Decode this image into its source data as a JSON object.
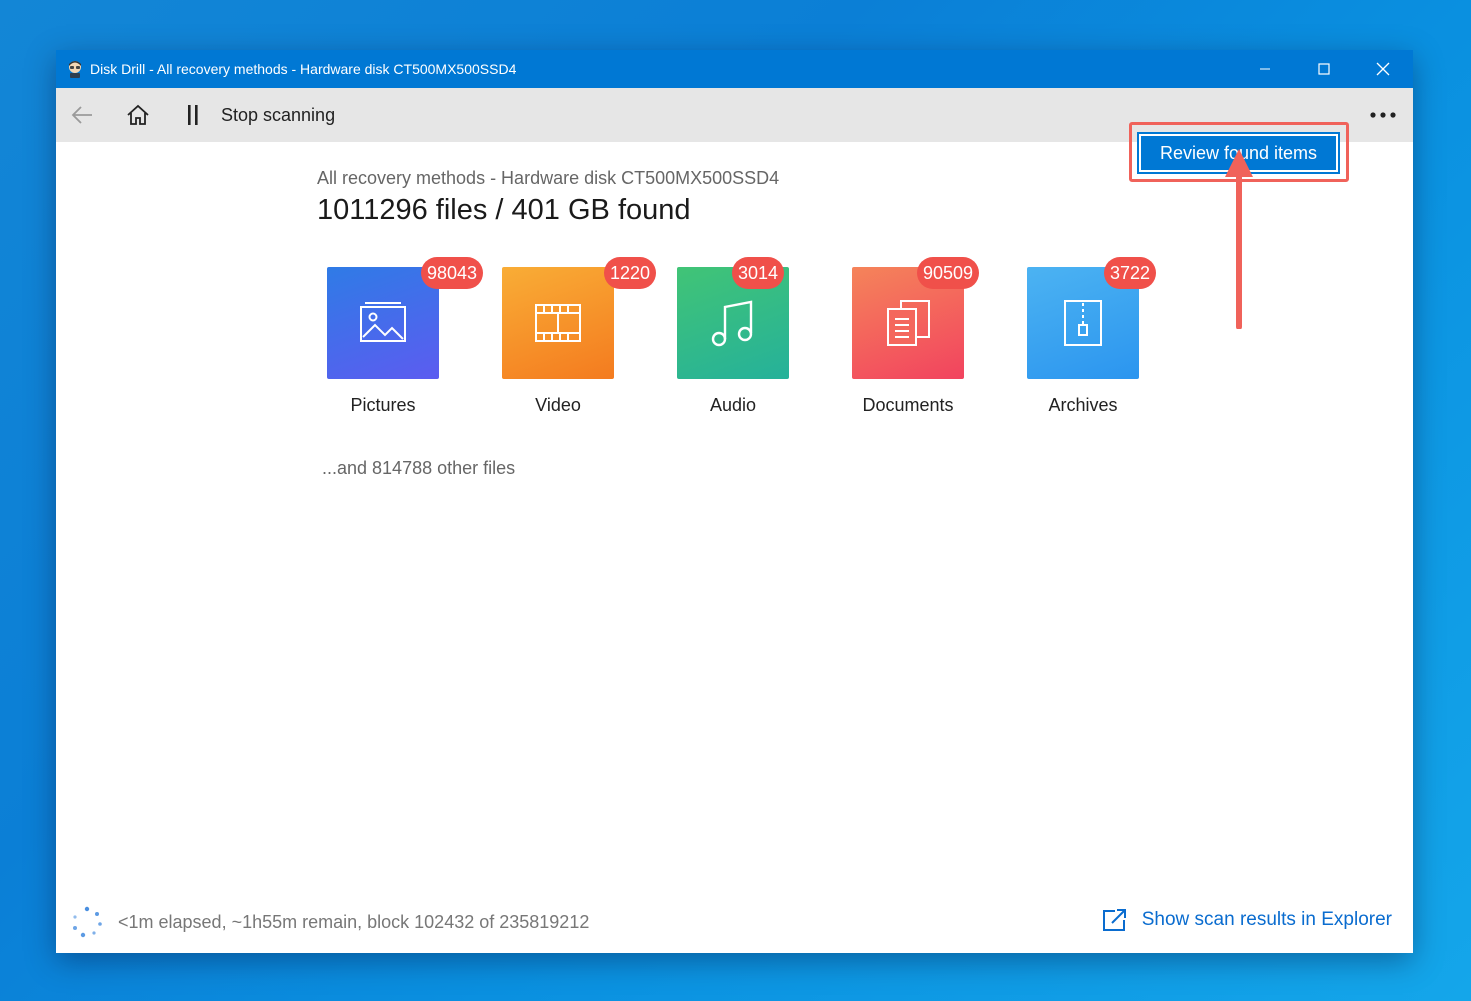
{
  "window": {
    "title": "Disk Drill - All recovery methods - Hardware disk CT500MX500SSD4"
  },
  "toolbar": {
    "stop_label": "Stop scanning",
    "review_label": "Review found items"
  },
  "scan": {
    "subtitle": "All recovery methods - Hardware disk CT500MX500SSD4",
    "headline": "1011296 files / 401 GB found",
    "other_files": "...and 814788 other files",
    "status": "<1m elapsed, ~1h55m remain, block 102432 of 235819212",
    "explorer_link": "Show scan results in Explorer"
  },
  "categories": [
    {
      "label": "Pictures",
      "count": "98043",
      "icon": "picture-icon",
      "colors": [
        "#2f7be6",
        "#5c5cf0"
      ]
    },
    {
      "label": "Video",
      "count": "1220",
      "icon": "film-icon",
      "colors": [
        "#f9ad36",
        "#f47b1f"
      ]
    },
    {
      "label": "Audio",
      "count": "3014",
      "icon": "music-note-icon",
      "colors": [
        "#41c476",
        "#25b19a"
      ]
    },
    {
      "label": "Documents",
      "count": "90509",
      "icon": "document-icon",
      "colors": [
        "#f5845a",
        "#f2435f"
      ]
    },
    {
      "label": "Archives",
      "count": "3722",
      "icon": "archive-icon",
      "colors": [
        "#4cb3f2",
        "#2b95ef"
      ]
    }
  ],
  "colors": {
    "accent": "#0078d4",
    "badge": "#f0504a",
    "annotation": "#f0625a",
    "link": "#0a6ccf"
  }
}
